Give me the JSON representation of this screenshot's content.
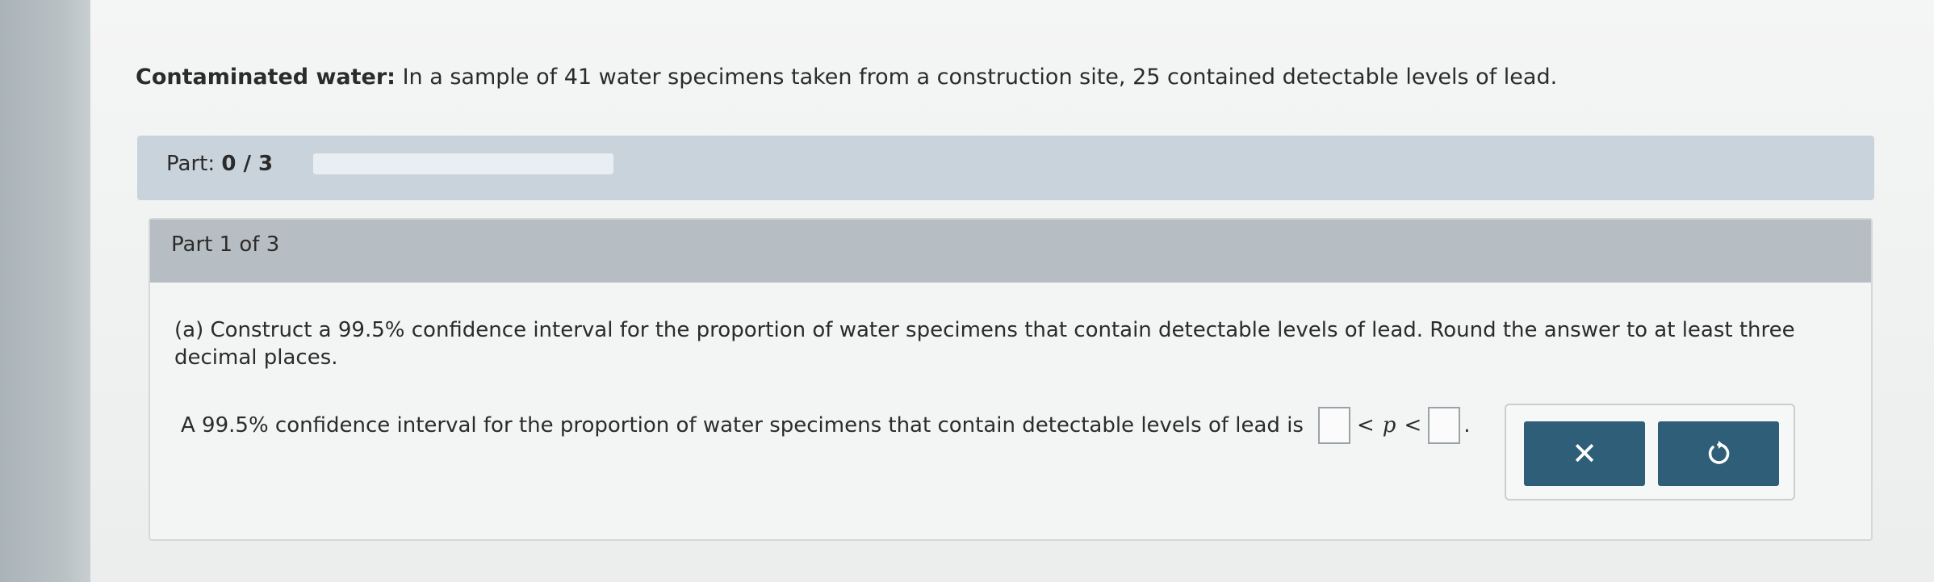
{
  "problem": {
    "title": "Contaminated water:",
    "text": "In a sample of 41 water specimens taken from a construction site, 25 contained detectable levels of lead."
  },
  "progress": {
    "label": "Part:",
    "value": "0 / 3",
    "fraction": 0
  },
  "part": {
    "header": "Part 1 of 3",
    "question": "(a) Construct a 99.5% confidence interval for the proportion of water specimens that contain detectable levels of lead. Round the answer to at least three decimal places.",
    "answer_prefix": "A 99.5% confidence interval for the proportion of water specimens that contain detectable levels of lead is",
    "lt_symbol": "<",
    "variable": "p",
    "period": "."
  },
  "buttons": {
    "clear_symbol": "✕",
    "clear_icon": "close-icon",
    "undo_icon": "undo-icon"
  },
  "colors": {
    "button_bg": "#2f5f78",
    "progress_bg": "#c9d3dc",
    "part_header_bg": "#b7bec3"
  }
}
